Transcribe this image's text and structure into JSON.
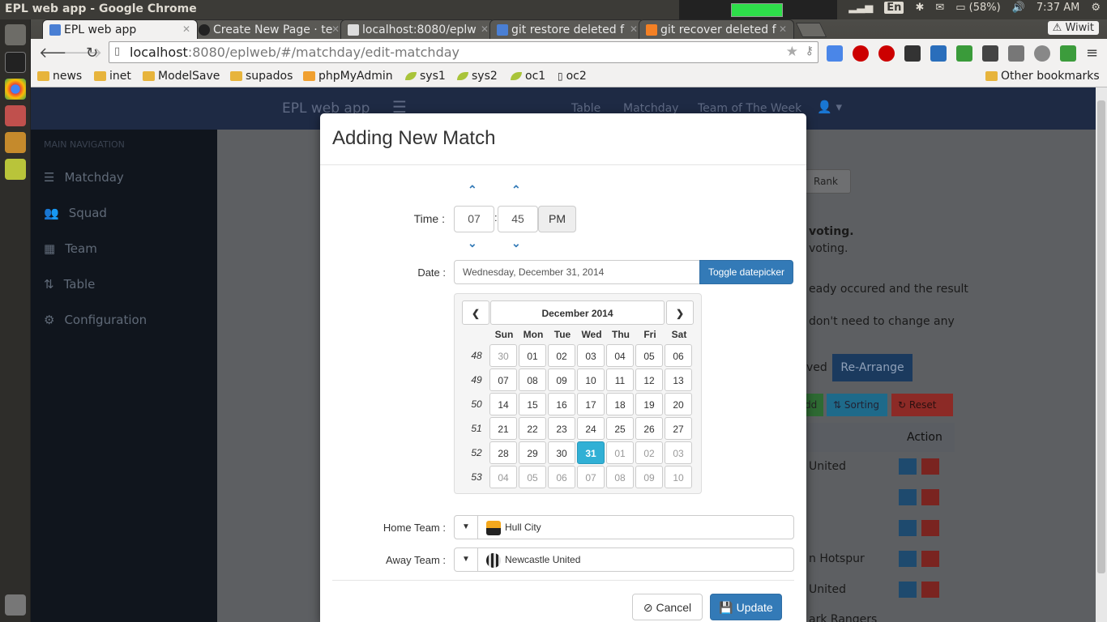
{
  "system": {
    "window_title": "EPL web app - Google Chrome",
    "keyboard": "En",
    "battery": "(58%)",
    "clock": "7:37 AM"
  },
  "chrome": {
    "tabs": [
      {
        "label": "EPL web app",
        "active": true
      },
      {
        "label": "Create New Page · te",
        "active": false
      },
      {
        "label": "localhost:8080/eplw",
        "active": false
      },
      {
        "label": "git restore deleted f",
        "active": false
      },
      {
        "label": "git recover deleted f",
        "active": false
      }
    ],
    "profile": "Wiwit",
    "url_host": "localhost",
    "url_path": ":8080/eplweb/#/matchday/edit-matchday",
    "bookmarks": [
      "news",
      "inet",
      "ModelSave",
      "supados",
      "phpMyAdmin",
      "sys1",
      "sys2",
      "oc1",
      "oc2"
    ],
    "other_bookmarks": "Other bookmarks"
  },
  "app": {
    "brand": "EPL web app",
    "nav": [
      "Table",
      "Matchday",
      "Team of The Week"
    ],
    "sidebar_header": "MAIN NAVIGATION",
    "sidebar_items": [
      "Matchday",
      "Squad",
      "Team",
      "Table",
      "Configuration"
    ],
    "bg": {
      "rank": "Rank",
      "voting_bold": "voting",
      "voting2": "voting.",
      "occured": "eady occured and the result",
      "change": "don't need to change any",
      "saved": "ved",
      "rearrange": "Re-Arrange",
      "add": "dd",
      "sorting": "Sorting",
      "reset": "Reset",
      "action": "Action",
      "row1": "United",
      "row4": "n Hotspur",
      "row5": "United",
      "row6": "ark Rangers"
    }
  },
  "modal": {
    "title": "Adding New Match",
    "time_label": "Time :",
    "hour": "07",
    "minute": "45",
    "meridian": "PM",
    "date_label": "Date :",
    "date_value": "Wednesday, December 31, 2014",
    "toggle_label": "Toggle datepicker",
    "calendar": {
      "month_title": "December 2014",
      "weekdays": [
        "Sun",
        "Mon",
        "Tue",
        "Wed",
        "Thu",
        "Fri",
        "Sat"
      ],
      "weeks": [
        {
          "num": "48",
          "days": [
            "30",
            "01",
            "02",
            "03",
            "04",
            "05",
            "06"
          ]
        },
        {
          "num": "49",
          "days": [
            "07",
            "08",
            "09",
            "10",
            "11",
            "12",
            "13"
          ]
        },
        {
          "num": "50",
          "days": [
            "14",
            "15",
            "16",
            "17",
            "18",
            "19",
            "20"
          ]
        },
        {
          "num": "51",
          "days": [
            "21",
            "22",
            "23",
            "24",
            "25",
            "26",
            "27"
          ]
        },
        {
          "num": "52",
          "days": [
            "28",
            "29",
            "30",
            "31",
            "01",
            "02",
            "03"
          ]
        },
        {
          "num": "53",
          "days": [
            "04",
            "05",
            "06",
            "07",
            "08",
            "09",
            "10"
          ]
        }
      ],
      "selected": "31"
    },
    "home_label": "Home Team :",
    "home_team": "Hull City",
    "away_label": "Away Team :",
    "away_team": "Newcastle United",
    "cancel": "Cancel",
    "update": "Update"
  },
  "colors": {
    "primary": "#337ab7",
    "selected_day": "#31b0d5",
    "header": "#1e2a44"
  }
}
